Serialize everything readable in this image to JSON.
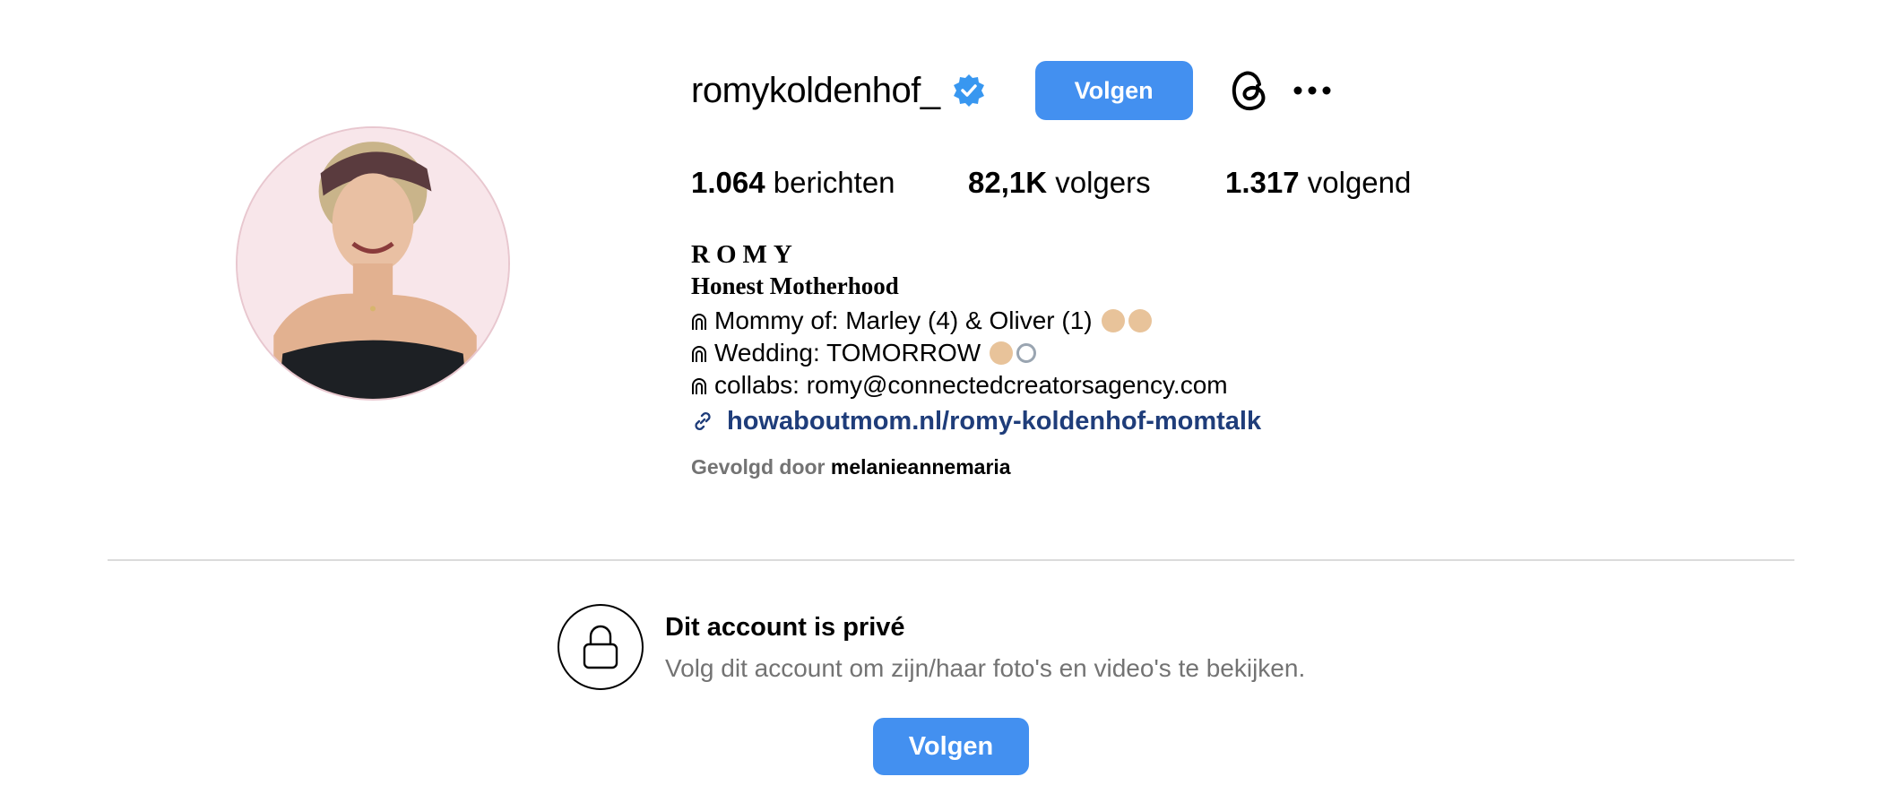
{
  "profile": {
    "username": "romykoldenhof_",
    "follow_label": "Volgen"
  },
  "stats": {
    "posts_count": "1.064",
    "posts_label": "berichten",
    "followers_count": "82,1K",
    "followers_label": "volgers",
    "following_count": "1.317",
    "following_label": "volgend"
  },
  "bio": {
    "name": "ROMY",
    "tagline": "Honest Motherhood",
    "lines": [
      "Mommy of: Marley (4) & Oliver (1)",
      "Wedding: TOMORROW",
      "collabs: romy@connectedcreatorsagency.com"
    ],
    "link": "howaboutmom.nl/romy-koldenhof-momtalk",
    "followed_by_label": "Gevolgd door",
    "followed_by_user": "melanieannemaria"
  },
  "private_notice": {
    "title": "Dit account is privé",
    "subtitle": "Volg dit account om zijn/haar foto's en video's te bekijken.",
    "follow_label": "Volgen"
  },
  "colors": {
    "accent": "#4390f0",
    "link": "#1f3d7a",
    "muted": "#737373",
    "verified": "#3897f0"
  },
  "icons": {
    "verified": "verified-badge-icon",
    "threads": "threads-icon",
    "more": "more-options-icon",
    "link": "link-icon",
    "lock": "lock-icon"
  }
}
